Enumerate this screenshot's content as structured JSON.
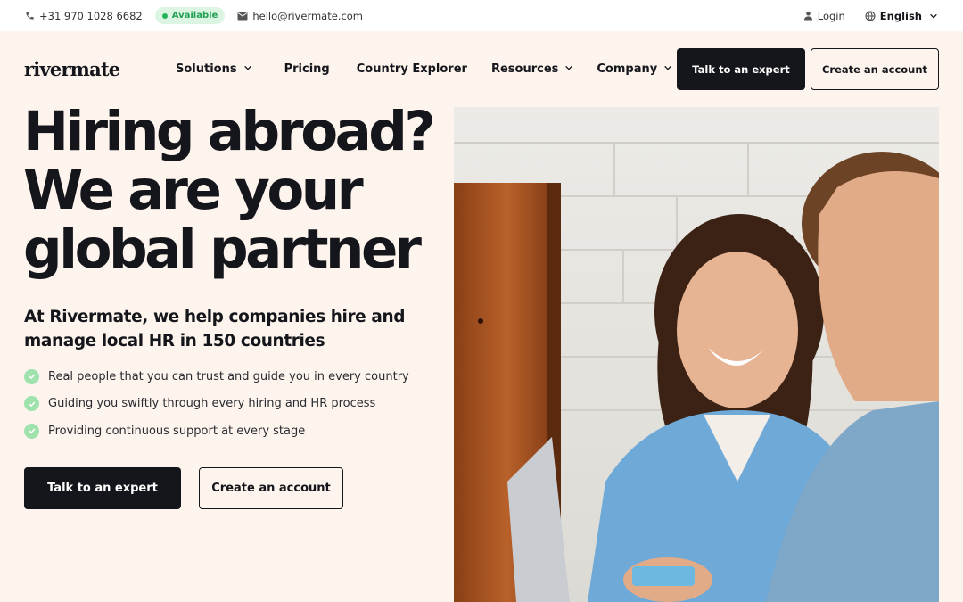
{
  "topbar": {
    "phone": "+31 970 1028 6682",
    "status": "Available",
    "email": "hello@rivermate.com",
    "login": "Login",
    "language": "English"
  },
  "nav": {
    "logo": "rivermate",
    "items": [
      {
        "label": "Solutions",
        "has_dropdown": true
      },
      {
        "label": "Pricing",
        "has_dropdown": false
      },
      {
        "label": "Country Explorer",
        "has_dropdown": false
      },
      {
        "label": "Resources",
        "has_dropdown": true
      },
      {
        "label": "Company",
        "has_dropdown": true
      }
    ],
    "cta_primary": "Talk to an expert",
    "cta_secondary": "Create an account"
  },
  "hero": {
    "headline_lines": [
      "Hiring abroad?",
      "We are your",
      "global partner"
    ],
    "subheading": "At Rivermate, we help companies hire and manage local HR in 150 countries",
    "features": [
      "Real people that you can trust and guide you in every country",
      "Guiding you swiftly through every hiring and HR process",
      "Providing continuous support at every stage"
    ],
    "cta_primary": "Talk to an expert",
    "cta_secondary": "Create an account"
  },
  "colors": {
    "background": "#fdf4ee",
    "text": "#15161b",
    "accent_green": "#9fe2ad",
    "status_green": "#26b15a"
  },
  "icons": [
    "phone-icon",
    "status-dot-icon",
    "mail-icon",
    "user-icon",
    "globe-icon",
    "chevron-down-icon",
    "check-circle-icon"
  ]
}
